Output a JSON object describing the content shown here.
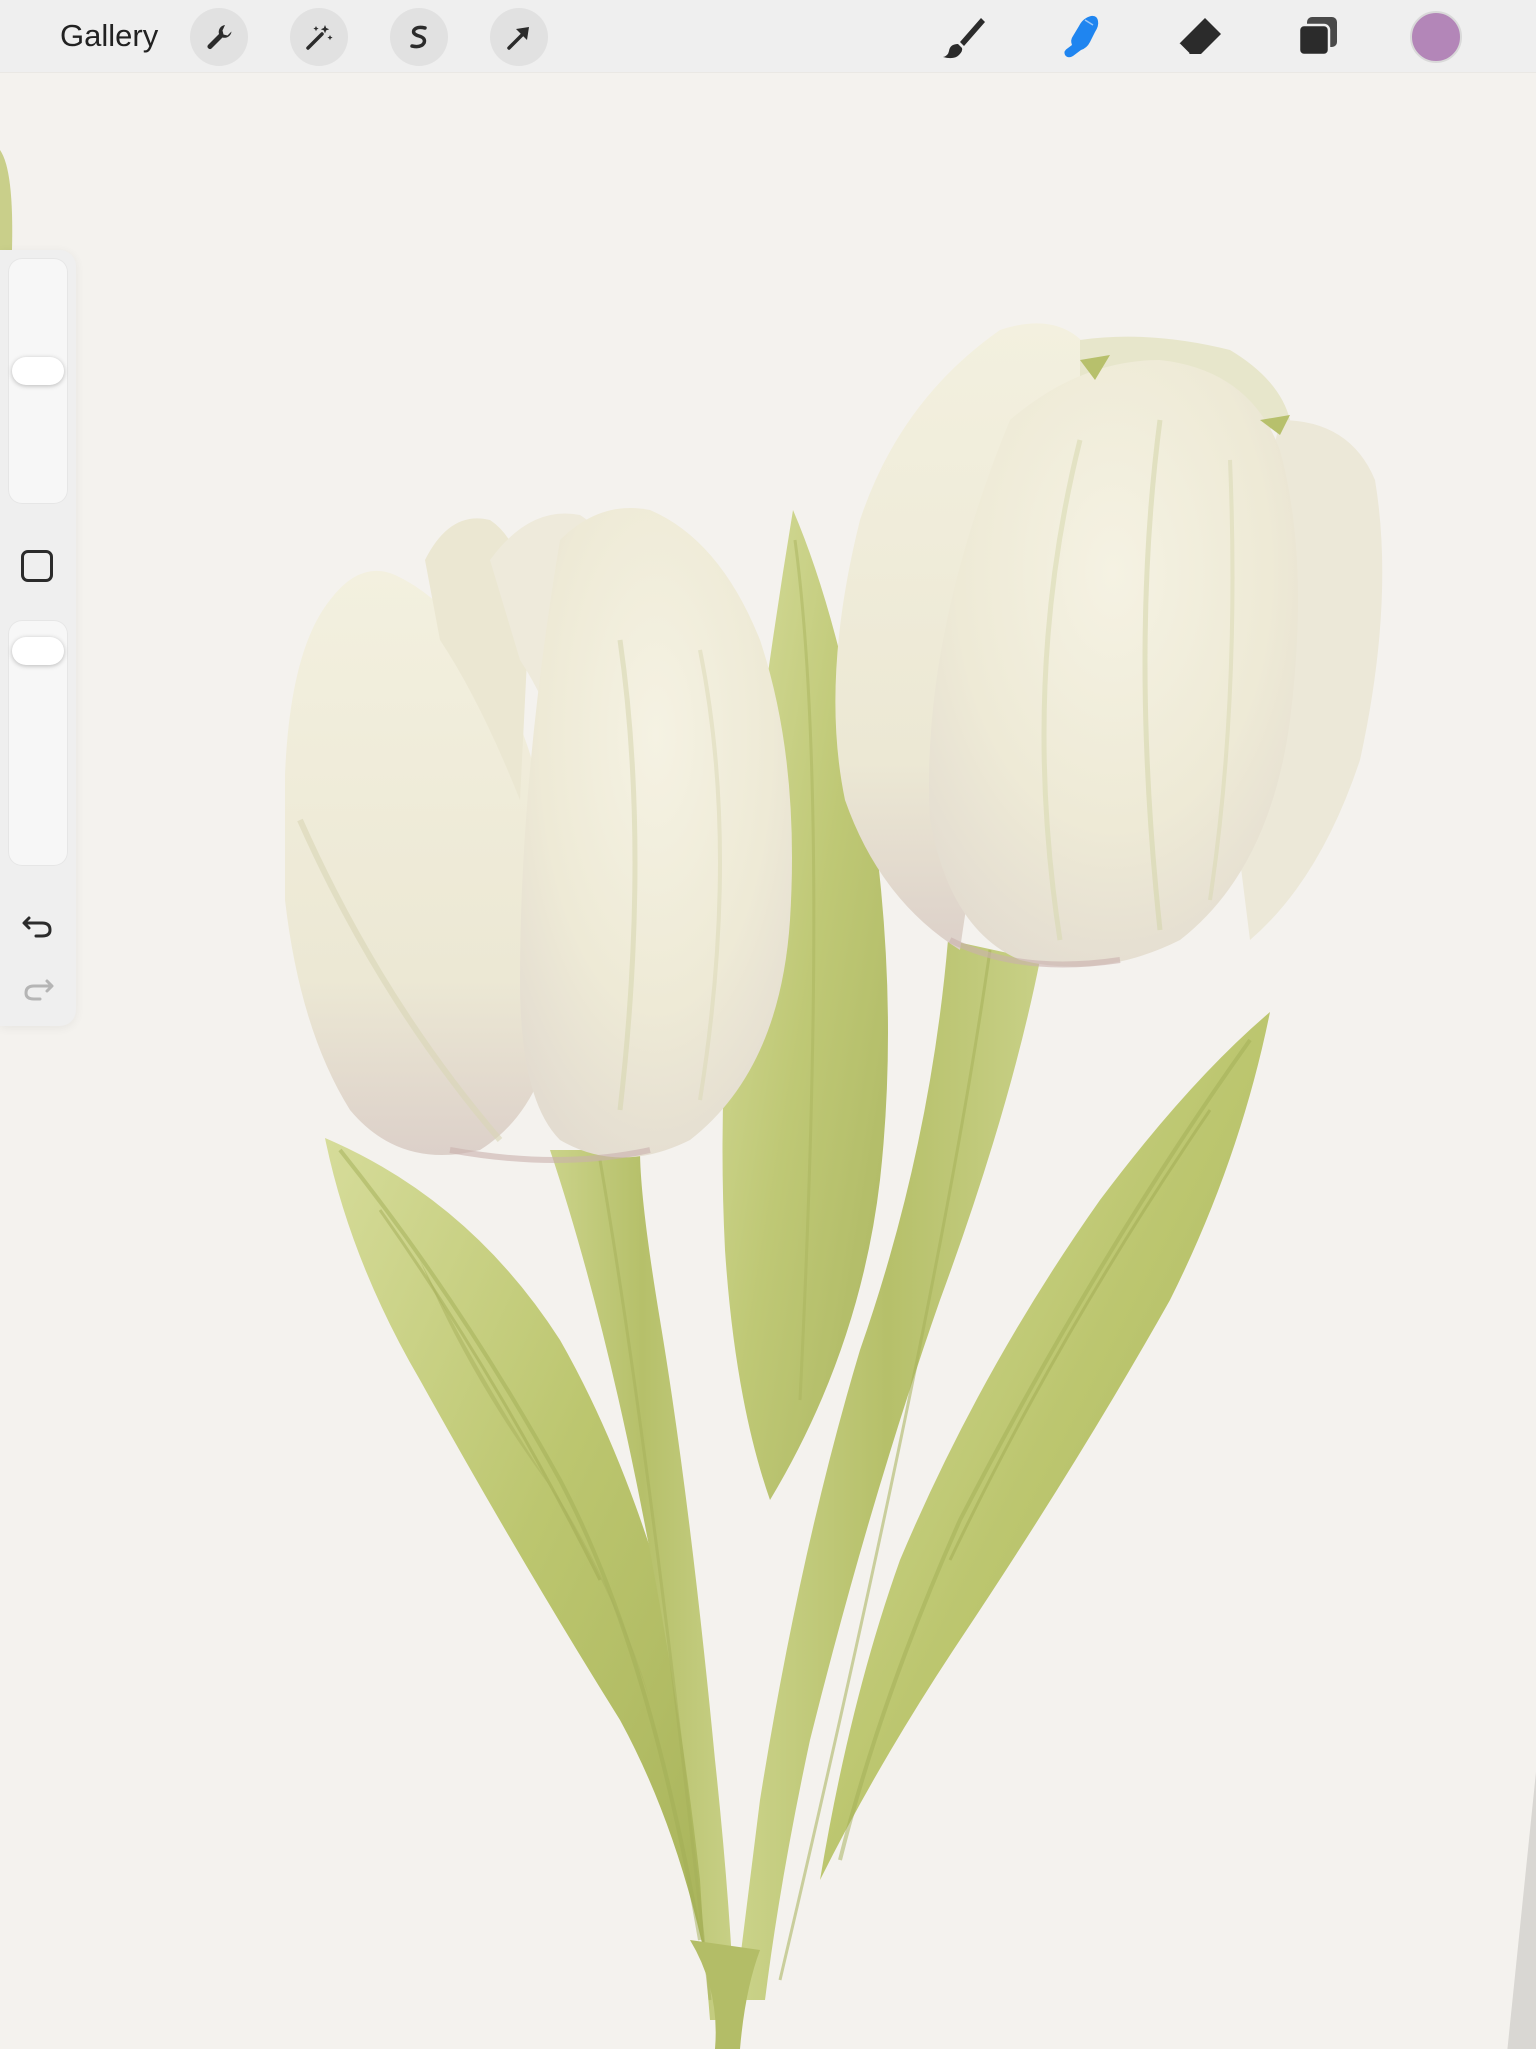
{
  "topbar": {
    "gallery_label": "Gallery"
  },
  "tools": {
    "left": [
      {
        "name": "actions",
        "icon": "wrench-icon"
      },
      {
        "name": "adjustments",
        "icon": "magic-wand-icon"
      },
      {
        "name": "selection",
        "icon": "selection-s-icon"
      },
      {
        "name": "transform",
        "icon": "arrow-cursor-icon"
      }
    ],
    "right": [
      {
        "name": "brush",
        "icon": "brush-icon",
        "active": false
      },
      {
        "name": "smudge",
        "icon": "smudge-finger-icon",
        "active": true
      },
      {
        "name": "eraser",
        "icon": "eraser-icon",
        "active": false
      },
      {
        "name": "layers",
        "icon": "layers-icon",
        "active": false
      }
    ],
    "active_color": "#b386b8"
  },
  "sidebar": {
    "brush_size_level": 0.55,
    "opacity_level": 0.94,
    "undo_icon": "undo-arrow-icon",
    "redo_icon": "redo-arrow-icon",
    "modify_icon": "square-modify-icon"
  },
  "colors": {
    "accent_blue": "#1f85f0",
    "icon_dark": "#2b2b2b",
    "toolbar_bg": "#efefef",
    "paper": "#f4f2ee",
    "petal": "#f2eee0",
    "leaf": "#bfc978"
  }
}
